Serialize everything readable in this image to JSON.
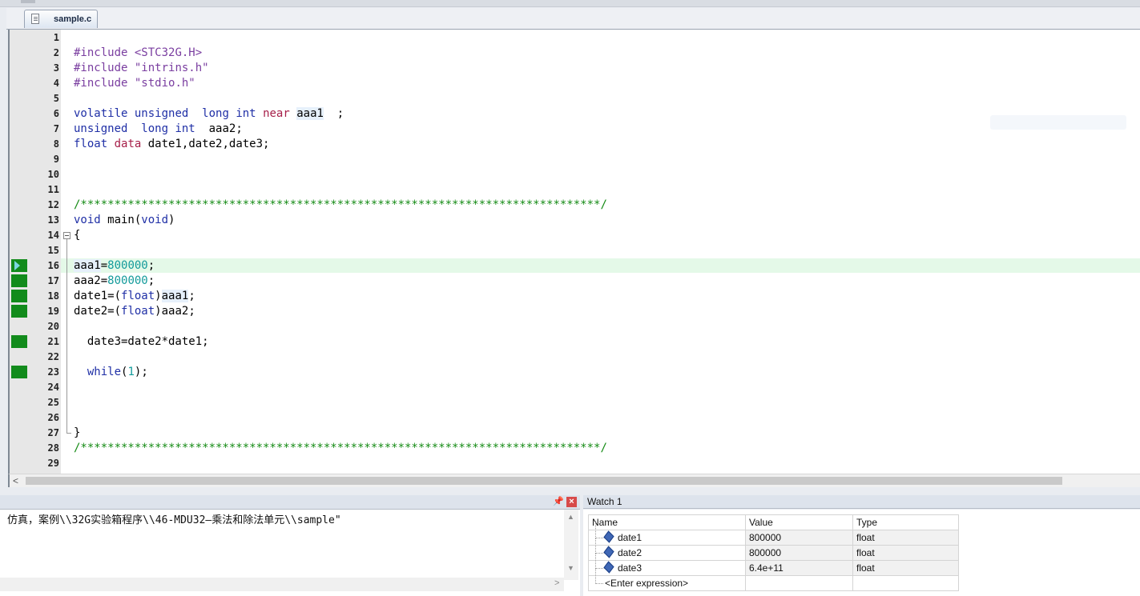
{
  "tab": {
    "filename": "sample.c"
  },
  "editor": {
    "lines": [
      {
        "n": "1",
        "segs": []
      },
      {
        "n": "2",
        "segs": [
          {
            "t": "#include",
            "c": "pp"
          },
          {
            "t": " <STC32G.H>",
            "c": "str"
          }
        ]
      },
      {
        "n": "3",
        "segs": [
          {
            "t": "#include",
            "c": "pp"
          },
          {
            "t": " \"intrins.h\"",
            "c": "str"
          }
        ]
      },
      {
        "n": "4",
        "segs": [
          {
            "t": "#include",
            "c": "pp"
          },
          {
            "t": " \"stdio.h\"",
            "c": "str"
          }
        ]
      },
      {
        "n": "5",
        "segs": []
      },
      {
        "n": "6",
        "segs": [
          {
            "t": "volatile",
            "c": "kw"
          },
          {
            "t": " "
          },
          {
            "t": "unsigned",
            "c": "kw"
          },
          {
            "t": "  "
          },
          {
            "t": "long",
            "c": "kw"
          },
          {
            "t": " "
          },
          {
            "t": "int",
            "c": "kw"
          },
          {
            "t": " "
          },
          {
            "t": "near",
            "c": "kw2"
          },
          {
            "t": " "
          },
          {
            "t": "aaa1",
            "c": "var"
          },
          {
            "t": "  ;"
          }
        ]
      },
      {
        "n": "7",
        "segs": [
          {
            "t": "unsigned",
            "c": "kw"
          },
          {
            "t": "  "
          },
          {
            "t": "long",
            "c": "kw"
          },
          {
            "t": " "
          },
          {
            "t": "int",
            "c": "kw"
          },
          {
            "t": "  aaa2;"
          }
        ]
      },
      {
        "n": "8",
        "segs": [
          {
            "t": "float",
            "c": "kw"
          },
          {
            "t": " "
          },
          {
            "t": "data",
            "c": "kw2"
          },
          {
            "t": " date1,date2,date3;"
          }
        ]
      },
      {
        "n": "9",
        "segs": []
      },
      {
        "n": "10",
        "segs": []
      },
      {
        "n": "11",
        "segs": []
      },
      {
        "n": "12",
        "segs": [
          {
            "t": "/*****************************************************************************/",
            "c": "cm"
          }
        ]
      },
      {
        "n": "13",
        "segs": [
          {
            "t": "void",
            "c": "kw"
          },
          {
            "t": " main("
          },
          {
            "t": "void",
            "c": "kw"
          },
          {
            "t": ")"
          }
        ]
      },
      {
        "n": "14",
        "segs": [
          {
            "t": "{"
          }
        ]
      },
      {
        "n": "15",
        "segs": []
      },
      {
        "n": "16",
        "segs": [
          {
            "t": "aaa1",
            "c": "var"
          },
          {
            "t": "="
          },
          {
            "t": "800000",
            "c": "num"
          },
          {
            "t": ";"
          }
        ]
      },
      {
        "n": "17",
        "segs": [
          {
            "t": "aaa2="
          },
          {
            "t": "800000",
            "c": "num"
          },
          {
            "t": ";"
          }
        ]
      },
      {
        "n": "18",
        "segs": [
          {
            "t": "date1=("
          },
          {
            "t": "float",
            "c": "kw"
          },
          {
            "t": ")"
          },
          {
            "t": "aaa1",
            "c": "var"
          },
          {
            "t": ";"
          }
        ]
      },
      {
        "n": "19",
        "segs": [
          {
            "t": "date2=("
          },
          {
            "t": "float",
            "c": "kw"
          },
          {
            "t": ")aaa2;"
          }
        ]
      },
      {
        "n": "20",
        "segs": []
      },
      {
        "n": "21",
        "segs": [
          {
            "t": "  date3=date2*date1;"
          }
        ]
      },
      {
        "n": "22",
        "segs": []
      },
      {
        "n": "23",
        "segs": [
          {
            "t": "  "
          },
          {
            "t": "while",
            "c": "kw"
          },
          {
            "t": "("
          },
          {
            "t": "1",
            "c": "num"
          },
          {
            "t": ");"
          }
        ]
      },
      {
        "n": "24",
        "segs": []
      },
      {
        "n": "25",
        "segs": []
      },
      {
        "n": "26",
        "segs": []
      },
      {
        "n": "27",
        "segs": [
          {
            "t": "}"
          }
        ]
      },
      {
        "n": "28",
        "segs": [
          {
            "t": "/*****************************************************************************/",
            "c": "cm"
          }
        ]
      },
      {
        "n": "29",
        "segs": []
      }
    ],
    "current_line": "16",
    "covered_lines": [
      "16",
      "17",
      "18",
      "19",
      "21",
      "23"
    ]
  },
  "output": {
    "text": "仿真，案例\\\\32G实验箱程序\\\\46-MDU32—乘法和除法单元\\\\sample\"",
    "pin_glyph": "📌",
    "close_glyph": "×"
  },
  "watch": {
    "title": "Watch 1",
    "headers": {
      "name": "Name",
      "value": "Value",
      "type": "Type"
    },
    "rows": [
      {
        "name": "date1",
        "value": "800000",
        "type": "float"
      },
      {
        "name": "date2",
        "value": "800000",
        "type": "float"
      },
      {
        "name": "date3",
        "value": "6.4e+11",
        "type": "float"
      }
    ],
    "enter_expression": "<Enter expression>"
  }
}
